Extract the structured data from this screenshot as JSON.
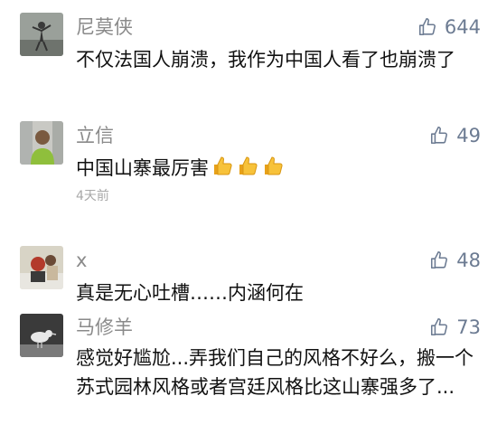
{
  "comments": [
    {
      "name": "尼莫侠",
      "likes": "644",
      "text": "不仅法国人崩溃，我作为中国人看了也崩溃了",
      "avatar": "avatar-photo"
    },
    {
      "name": "立信",
      "likes": "49",
      "text": "中国山寨最厉害",
      "emojis": [
        "thumbs-up-emoji",
        "thumbs-up-emoji",
        "thumbs-up-emoji"
      ],
      "time": "4天前",
      "avatar": "avatar-photo"
    },
    {
      "name": "x",
      "likes": "48",
      "text": "真是无心吐槽……内涵何在",
      "avatar": "avatar-photo"
    },
    {
      "name": "马修羊",
      "likes": "73",
      "text": "感觉好尴尬...弄我们自己的风格不好么，搬一个苏式园林风格或者宫廷风格比这山寨强多了...",
      "avatar": "avatar-photo"
    }
  ],
  "icons": {
    "like": "thumbs-up-outline-icon",
    "emoji": "thumbs-up-emoji"
  },
  "colors": {
    "name": "#8a8a8a",
    "like_count": "#6c7b92",
    "text": "#111111",
    "time": "#a8a8a8"
  }
}
